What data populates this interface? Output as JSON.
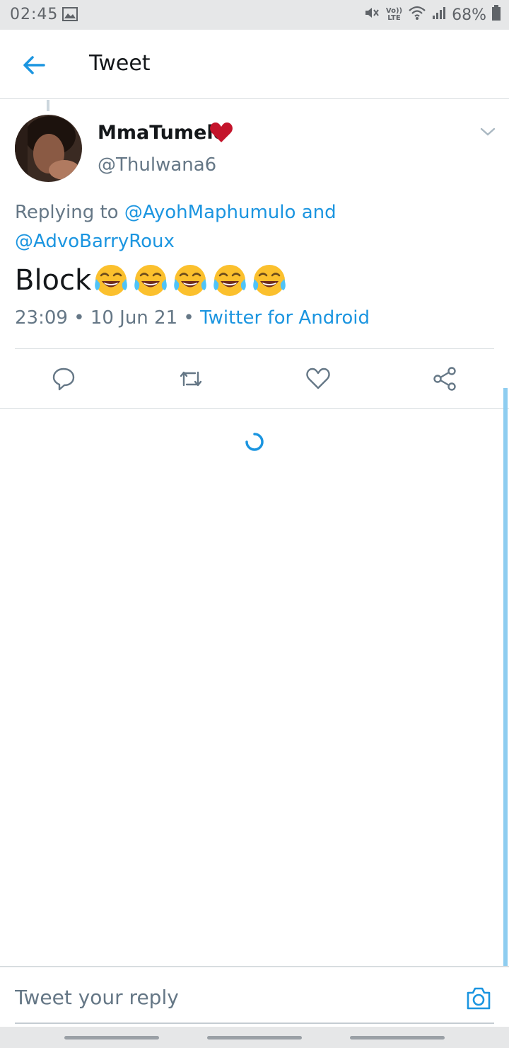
{
  "status_bar": {
    "time": "02:45",
    "volte_top": "Vo))",
    "volte_bottom": "LTE",
    "battery_percent": "68%",
    "icons": [
      "gallery-icon",
      "mute-icon",
      "volte-icon",
      "wifi-icon",
      "signal-icon",
      "battery-icon"
    ]
  },
  "app_bar": {
    "title": "Tweet",
    "back_icon": "arrow-left-icon"
  },
  "tweet": {
    "display_name": "MmaTumelo",
    "handle": "@Thulwana6",
    "replying_prefix": "Replying to",
    "reply_mention_1": "@AyohMaphumulo",
    "reply_joiner": "and",
    "reply_mention_2": "@AdvoBarryRoux",
    "text": "Block",
    "emoji": "😂😂😂😂😂",
    "emoji_count": 5,
    "time": "23:09",
    "date": "10 Jun 21",
    "source": "Twitter for Android",
    "separator": "•"
  },
  "actions": {
    "icons": [
      "reply-icon",
      "retweet-icon",
      "like-icon",
      "share-icon"
    ]
  },
  "composer": {
    "placeholder": "Tweet your reply",
    "camera_icon": "camera-icon"
  },
  "colors": {
    "accent": "#1b95e0",
    "secondary_text": "#657786",
    "primary_text": "#14171a",
    "heart": "#c4142b",
    "divider": "#d8dde0"
  }
}
